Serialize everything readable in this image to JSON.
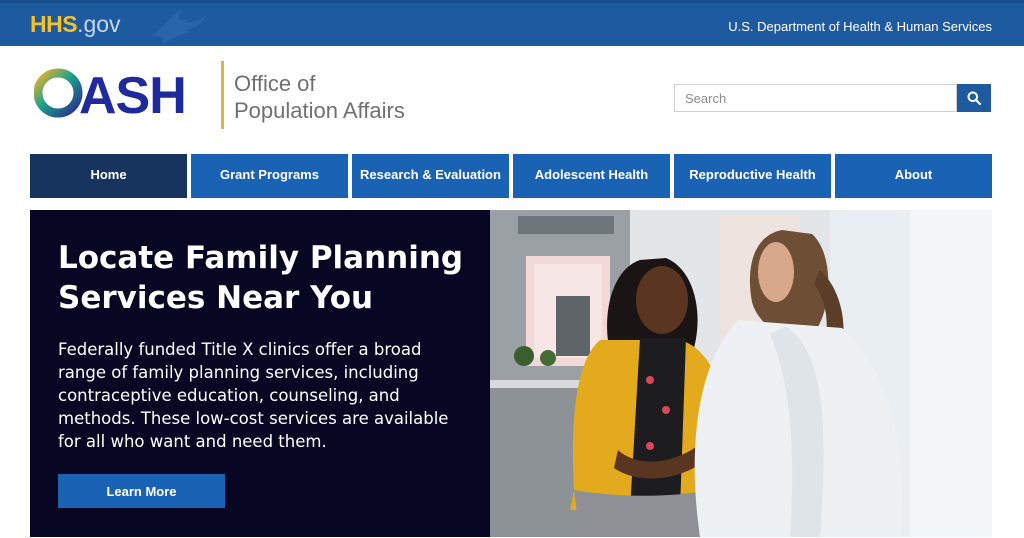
{
  "topbar": {
    "logo_hhs": "HHS",
    "logo_gov": ".gov",
    "department": "U.S. Department of Health & Human Services"
  },
  "header": {
    "logo_text": "OASH",
    "office_line1": "Office of",
    "office_line2": "Population Affairs",
    "search_placeholder": "Search"
  },
  "nav": {
    "items": [
      {
        "label": "Home",
        "active": true
      },
      {
        "label": "Grant Programs"
      },
      {
        "label": "Research & Evaluation"
      },
      {
        "label": "Adolescent Health"
      },
      {
        "label": "Reproductive Health"
      },
      {
        "label": "About"
      }
    ]
  },
  "hero": {
    "title_line1": "Locate Family Planning",
    "title_line2": "Services Near You",
    "body": "Federally funded Title X clinics offer a broad range of family planning services, including contraceptive education, counseling, and methods. These low-cost services are available for all who want and need them.",
    "cta_label": "Learn More"
  },
  "colors": {
    "hhs_blue": "#1e5aa0",
    "nav_blue": "#1a62b3",
    "nav_active": "#16345e",
    "hero_bg": "#070724",
    "accent_gold": "#e3b341"
  }
}
